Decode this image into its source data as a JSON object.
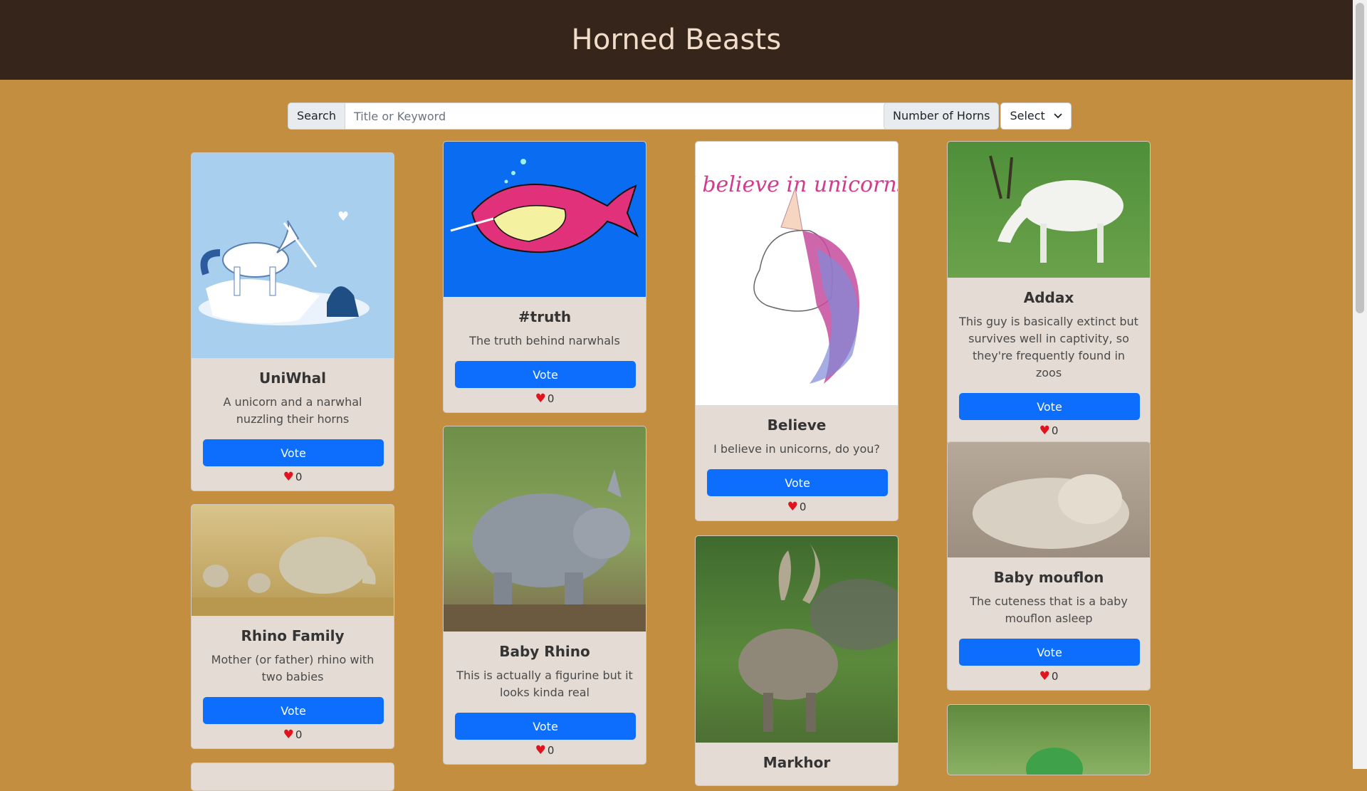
{
  "header": {
    "title": "Horned Beasts"
  },
  "search": {
    "label": "Search",
    "placeholder": "Title or Keyword"
  },
  "horns_filter": {
    "label": "Number of Horns",
    "selected": "Select"
  },
  "vote_label": "Vote",
  "cards": [
    {
      "title": "UniWhal",
      "description": "A unicorn and a narwhal nuzzling their horns",
      "votes": "0"
    },
    {
      "title": "Rhino Family",
      "description": "Mother (or father) rhino with two babies",
      "votes": "0"
    },
    {
      "title": "#truth",
      "description": "The truth behind narwhals",
      "votes": "0"
    },
    {
      "title": "Baby Rhino",
      "description": "This is actually a figurine but it looks kinda real",
      "votes": "0"
    },
    {
      "title": "Believe",
      "description": "I believe in unicorns, do you?",
      "votes": "0"
    },
    {
      "title": "Markhor",
      "description": "",
      "votes": ""
    },
    {
      "title": "Addax",
      "description": "This guy is basically extinct but survives well in captivity, so they're frequently found in zoos",
      "votes": "0"
    },
    {
      "title": "Baby mouflon",
      "description": "The cuteness that is a baby mouflon asleep",
      "votes": "0"
    }
  ],
  "image_text": {
    "believe_script": "I believe in unicorns"
  },
  "colors": {
    "header_bg": "#36251a",
    "page_bg": "#c48e41",
    "card_bg": "#e4dbd4",
    "button": "#0d6efd",
    "heart": "#e0141e"
  }
}
